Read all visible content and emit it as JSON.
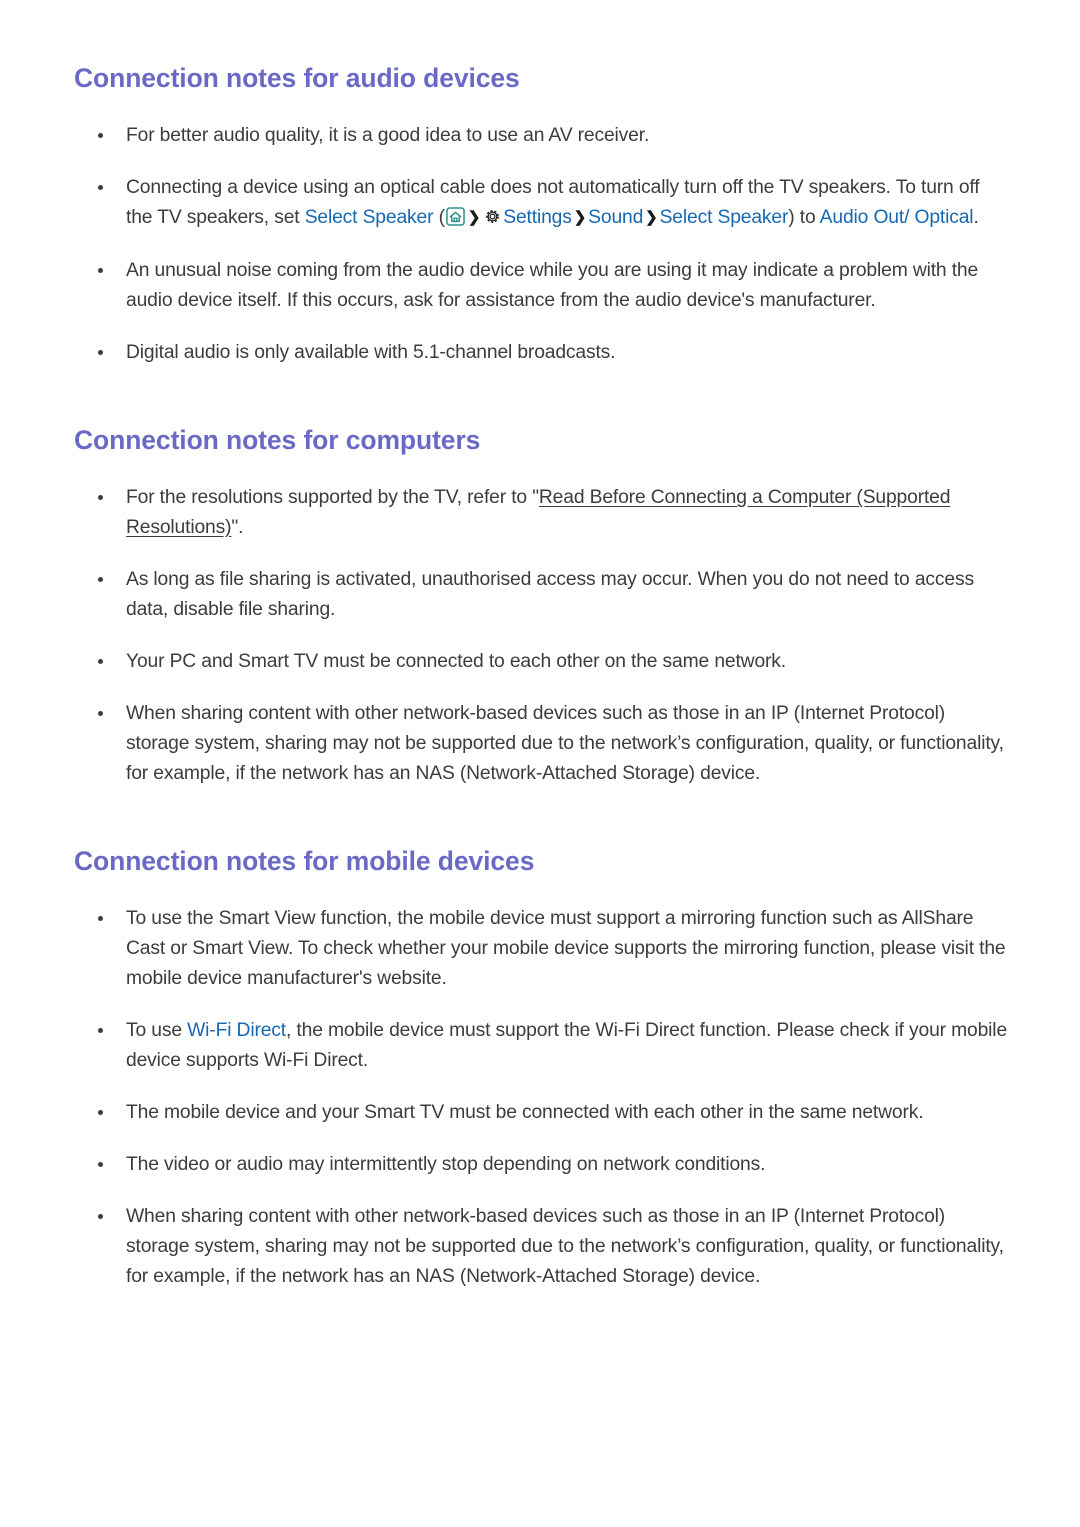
{
  "document": {
    "type": "tv-e-manual-page",
    "colors": {
      "heading": "#6a6ac6",
      "link": "#1668b3",
      "body_text": "#3c3c3c",
      "home_icon": "#2f8f8f",
      "gear_icon": "#1a1a1a",
      "background": "#ffffff"
    }
  },
  "sections": [
    {
      "title": "Connection notes for audio devices",
      "bullets": [
        {
          "id": "audio-av-receiver",
          "parts": [
            {
              "type": "text",
              "value": "For better audio quality, it is a good idea to use an AV receiver."
            }
          ]
        },
        {
          "id": "audio-optical-cable",
          "parts": [
            {
              "type": "text",
              "value": "Connecting a device using an optical cable does not automatically turn off the TV speakers. To turn off the TV speakers, set "
            },
            {
              "type": "link",
              "value": "Select Speaker"
            },
            {
              "type": "text",
              "value": " ("
            },
            {
              "type": "icon",
              "value": "home-icon"
            },
            {
              "type": "chevron",
              "value": "❯"
            },
            {
              "type": "icon",
              "value": "gear-icon"
            },
            {
              "type": "link",
              "value": "Settings"
            },
            {
              "type": "chevron",
              "value": "❯"
            },
            {
              "type": "link",
              "value": "Sound"
            },
            {
              "type": "chevron",
              "value": "❯"
            },
            {
              "type": "link",
              "value": "Select Speaker"
            },
            {
              "type": "text",
              "value": ") to "
            },
            {
              "type": "link",
              "value": "Audio Out/ Optical"
            },
            {
              "type": "text",
              "value": "."
            }
          ]
        },
        {
          "id": "audio-unusual-noise",
          "parts": [
            {
              "type": "text",
              "value": "An unusual noise coming from the audio device while you are using it may indicate a problem with the audio device itself. If this occurs, ask for assistance from the audio device's manufacturer."
            }
          ]
        },
        {
          "id": "audio-digital-5-1",
          "parts": [
            {
              "type": "text",
              "value": "Digital audio is only available with 5.1-channel broadcasts."
            }
          ]
        }
      ]
    },
    {
      "title": "Connection notes for computers",
      "bullets": [
        {
          "id": "computers-resolutions",
          "parts": [
            {
              "type": "text",
              "value": "For the resolutions supported by the TV, refer to \""
            },
            {
              "type": "underline",
              "value": "Read Before Connecting a Computer (Supported Resolutions)"
            },
            {
              "type": "text",
              "value": "\"."
            }
          ]
        },
        {
          "id": "computers-file-sharing",
          "parts": [
            {
              "type": "text",
              "value": "As long as file sharing is activated, unauthorised access may occur. When you do not need to access data, disable file sharing."
            }
          ]
        },
        {
          "id": "computers-same-network",
          "parts": [
            {
              "type": "text",
              "value": "Your PC and Smart TV must be connected to each other on the same network."
            }
          ]
        },
        {
          "id": "computers-network-based-devices",
          "parts": [
            {
              "type": "text",
              "value": "When sharing content with other network-based devices such as those in an IP (Internet Protocol) storage system, sharing may not be supported due to the network’s configuration, quality, or functionality, for example, if the network has an NAS (Network-Attached Storage) device."
            }
          ]
        }
      ]
    },
    {
      "title": "Connection notes for mobile devices",
      "bullets": [
        {
          "id": "mobile-smart-view",
          "parts": [
            {
              "type": "text",
              "value": "To use the Smart View function, the mobile device must support a mirroring function such as AllShare Cast or Smart View. To check whether your mobile device supports the mirroring function, please visit the mobile device manufacturer's website."
            }
          ]
        },
        {
          "id": "mobile-wifi-direct",
          "parts": [
            {
              "type": "text",
              "value": "To use "
            },
            {
              "type": "link",
              "value": "Wi-Fi Direct"
            },
            {
              "type": "text",
              "value": ", the mobile device must support the Wi-Fi Direct function. Please check if your mobile device supports Wi-Fi Direct."
            }
          ]
        },
        {
          "id": "mobile-same-network",
          "parts": [
            {
              "type": "text",
              "value": "The mobile device and your Smart TV must be connected with each other in the same network."
            }
          ]
        },
        {
          "id": "mobile-intermittent-stop",
          "parts": [
            {
              "type": "text",
              "value": "The video or audio may intermittently stop depending on network conditions."
            }
          ]
        },
        {
          "id": "mobile-network-based-devices",
          "parts": [
            {
              "type": "text",
              "value": "When sharing content with other network-based devices such as those in an IP (Internet Protocol) storage system, sharing may not be supported due to the network’s configuration, quality, or functionality, for example, if the network has an NAS (Network-Attached Storage) device."
            }
          ]
        }
      ]
    }
  ]
}
